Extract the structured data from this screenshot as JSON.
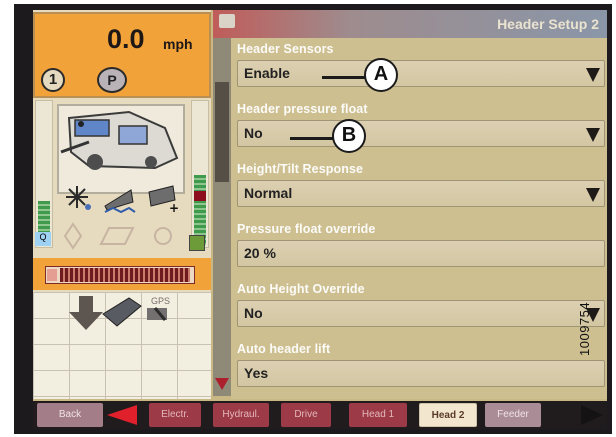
{
  "status": {
    "speed_value": "0.0",
    "speed_unit": "mph",
    "gear": "1",
    "park": "P"
  },
  "window": {
    "title": "Header Setup 2"
  },
  "settings": [
    {
      "label": "Header Sensors",
      "value": "Enable",
      "has_dropdown": true
    },
    {
      "label": "Header pressure float",
      "value": "No",
      "has_dropdown": true
    },
    {
      "label": "Height/Tilt Response",
      "value": "Normal",
      "has_dropdown": true
    },
    {
      "label": "Pressure float override",
      "value": "20 %",
      "has_dropdown": false
    },
    {
      "label": "Auto Height Override",
      "value": "No",
      "has_dropdown": true
    },
    {
      "label": "Auto header lift",
      "value": "Yes",
      "has_dropdown": false
    }
  ],
  "tabs": [
    {
      "label": "Back"
    },
    {
      "label": "Electr."
    },
    {
      "label": "Hydraul."
    },
    {
      "label": "Drive"
    },
    {
      "label": "Head 1"
    },
    {
      "label": "Head 2",
      "active": true
    },
    {
      "label": "Feeder"
    }
  ],
  "icons": {
    "machine": "combine-harvester-icon",
    "gps": "GPS"
  },
  "callouts": {
    "a": "A",
    "b": "B"
  },
  "figure_id": "1009754",
  "colors": {
    "status_orange": "#f1a33a",
    "panel_tan": "#cebf91",
    "active_tab": "#f2e6cf",
    "inactive_tab": "#9c3a48",
    "gauge_green": "#3f9a4c"
  }
}
